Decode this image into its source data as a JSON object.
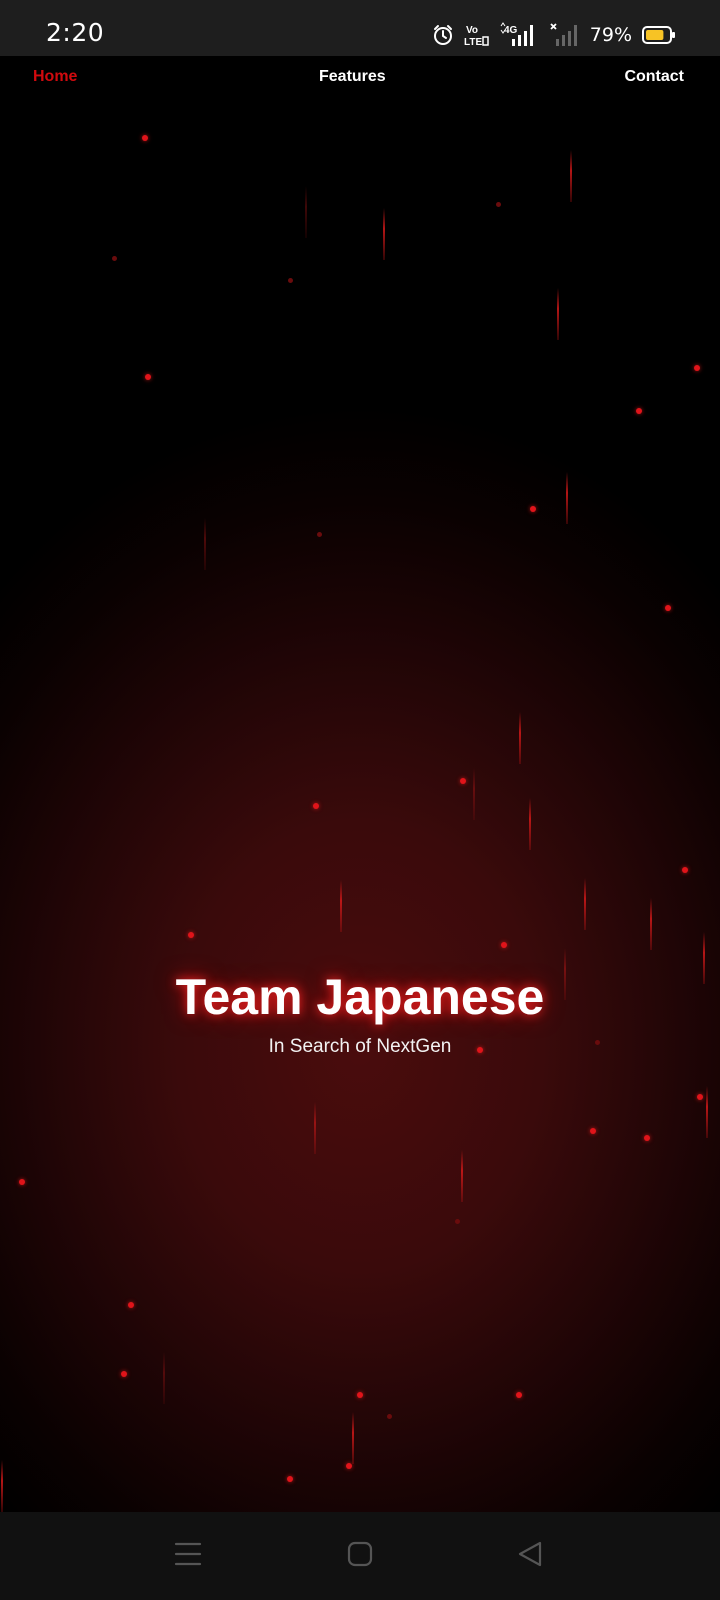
{
  "status_bar": {
    "time": "2:20",
    "icons": [
      "alarm-icon",
      "volte-icon",
      "4g-signal-icon",
      "no-signal-icon",
      "battery-icon"
    ],
    "volte_label": "Vo LTE",
    "network_label": "4G",
    "battery_percent": "79%",
    "battery_level": 0.79,
    "battery_color": "#f7c325"
  },
  "nav": {
    "items": [
      {
        "label": "Home",
        "active": true
      },
      {
        "label": "Features",
        "active": false
      },
      {
        "label": "Contact",
        "active": false
      }
    ],
    "active_color": "#d10a0e"
  },
  "hero": {
    "title": "Team Japanese",
    "subtitle": "In Search of NextGen",
    "accent_color": "#e0141a"
  },
  "system_nav": {
    "buttons": [
      "menu-icon",
      "home-square-icon",
      "back-triangle-icon"
    ]
  }
}
